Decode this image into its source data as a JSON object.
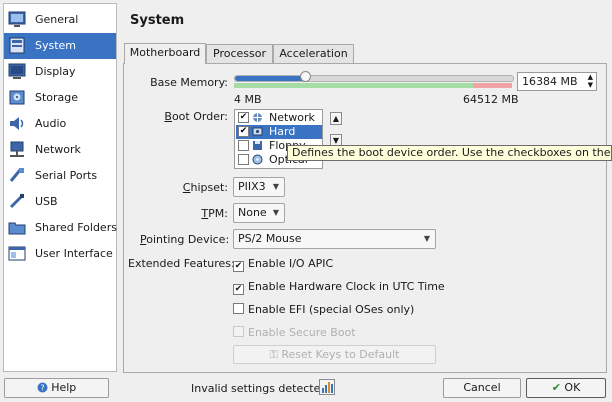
{
  "sidebar": {
    "items": [
      {
        "label": "General",
        "icon": "general-icon"
      },
      {
        "label": "System",
        "icon": "system-icon",
        "selected": true
      },
      {
        "label": "Display",
        "icon": "display-icon"
      },
      {
        "label": "Storage",
        "icon": "storage-icon"
      },
      {
        "label": "Audio",
        "icon": "audio-icon"
      },
      {
        "label": "Network",
        "icon": "network-icon"
      },
      {
        "label": "Serial Ports",
        "icon": "serial-ports-icon"
      },
      {
        "label": "USB",
        "icon": "usb-icon"
      },
      {
        "label": "Shared Folders",
        "icon": "shared-folders-icon"
      },
      {
        "label": "User Interface",
        "icon": "user-interface-icon"
      }
    ]
  },
  "page": {
    "title": "System"
  },
  "tabs": [
    {
      "label": "Motherboard",
      "active": true
    },
    {
      "label": "Processor"
    },
    {
      "label": "Acceleration"
    }
  ],
  "motherboard": {
    "base_memory": {
      "label": "Base Memory:",
      "min_label": "4 MB",
      "max_label": "64512 MB",
      "value": "16384 MB",
      "value_mb": 16384,
      "min_mb": 4,
      "max_mb": 64512
    },
    "boot_order": {
      "label": "Boot Order:",
      "items": [
        {
          "label": "Network",
          "checked": true,
          "icon": "network-boot-icon"
        },
        {
          "label": "Hard Disk",
          "checked": true,
          "icon": "hard-disk-icon",
          "selected": true
        },
        {
          "label": "Floppy",
          "checked": false,
          "icon": "floppy-icon"
        },
        {
          "label": "Optical",
          "checked": false,
          "icon": "optical-icon"
        }
      ],
      "tooltip": "Defines the boot device order. Use the checkboxes on the left to"
    },
    "chipset": {
      "label": "Chipset:",
      "value": "PIIX3"
    },
    "tpm": {
      "label": "TPM:",
      "value": "None"
    },
    "pointing_device": {
      "label": "Pointing Device:",
      "value": "PS/2 Mouse"
    },
    "extended_features": {
      "label": "Extended Features:",
      "options": [
        {
          "label": "Enable I/O APIC",
          "checked": true,
          "enabled": true
        },
        {
          "label": "Enable Hardware Clock in UTC Time",
          "checked": true,
          "enabled": true
        },
        {
          "label": "Enable EFI (special OSes only)",
          "checked": false,
          "enabled": true
        },
        {
          "label": "Enable Secure Boot",
          "checked": false,
          "enabled": false
        }
      ],
      "restore_keys_label": "Reset Keys to Default"
    }
  },
  "footer": {
    "help_label": "Help",
    "status_text": "Invalid settings detected",
    "cancel_label": "Cancel",
    "ok_label": "OK"
  },
  "colors": {
    "selection": "#3a73c4",
    "tooltip_bg": "#ffffdc",
    "memory_safe": "#a6dca6",
    "memory_danger": "#f2a3a3"
  }
}
